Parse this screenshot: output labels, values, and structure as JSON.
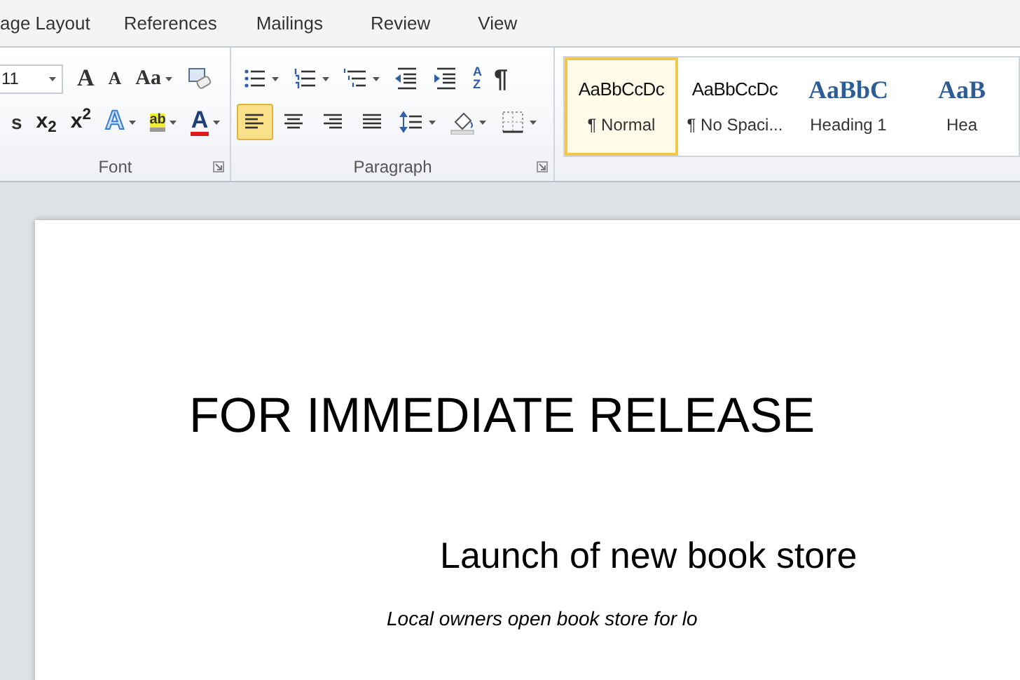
{
  "ribbon_tabs": [
    {
      "label": "age Layout"
    },
    {
      "label": "References"
    },
    {
      "label": "Mailings"
    },
    {
      "label": "Review"
    },
    {
      "label": "View"
    }
  ],
  "font_group": {
    "title": "Font",
    "font_size": "11",
    "row1": [
      {
        "kind": "grow",
        "label": "A"
      },
      {
        "kind": "shrink",
        "label": "A"
      },
      {
        "kind": "case",
        "label": "Aa",
        "dropdown": true
      },
      {
        "kind": "clear"
      }
    ],
    "row2": [
      {
        "kind": "strike",
        "label": "s"
      },
      {
        "kind": "sub",
        "label": "x$_{2}$"
      },
      {
        "kind": "sup",
        "label": "x$^{2}$"
      },
      {
        "kind": "effects",
        "label": "A",
        "dropdown": true
      },
      {
        "kind": "highlight",
        "label": "ab",
        "dropdown": true
      },
      {
        "kind": "color",
        "label": "A",
        "dropdown": true
      }
    ]
  },
  "paragraph_group": {
    "title": "Paragraph",
    "row1": [
      {
        "kind": "bullets",
        "dropdown": true
      },
      {
        "kind": "numbering",
        "dropdown": true
      },
      {
        "kind": "multilevel",
        "dropdown": true
      },
      {
        "kind": "outdent"
      },
      {
        "kind": "indent"
      },
      {
        "kind": "sort",
        "label": "AZ"
      },
      {
        "kind": "pilcrow",
        "label": "¶"
      }
    ],
    "row2": [
      {
        "kind": "align-left",
        "selected": true
      },
      {
        "kind": "align-center",
        "selected": false
      },
      {
        "kind": "align-right",
        "selected": false
      },
      {
        "kind": "justify",
        "selected": false
      },
      {
        "kind": "line-spacing",
        "dropdown": true
      },
      {
        "kind": "shading",
        "dropdown": true
      },
      {
        "kind": "borders",
        "dropdown": true
      }
    ]
  },
  "styles": [
    {
      "kind": "normal",
      "sample": "AaBbCcDc",
      "name": "¶ Normal",
      "selected": true
    },
    {
      "kind": "normal",
      "sample": "AaBbCcDc",
      "name": "¶ No Spaci...",
      "selected": false
    },
    {
      "kind": "heading",
      "sample": "AaBbC",
      "name": "Heading 1",
      "selected": false
    },
    {
      "kind": "heading",
      "sample": "AaB",
      "name": "Hea",
      "selected": false
    }
  ],
  "document": {
    "title": "FOR IMMEDIATE RELEASE",
    "headline": "Launch of new book store",
    "subtitle": "Local owners open book store for lo"
  }
}
